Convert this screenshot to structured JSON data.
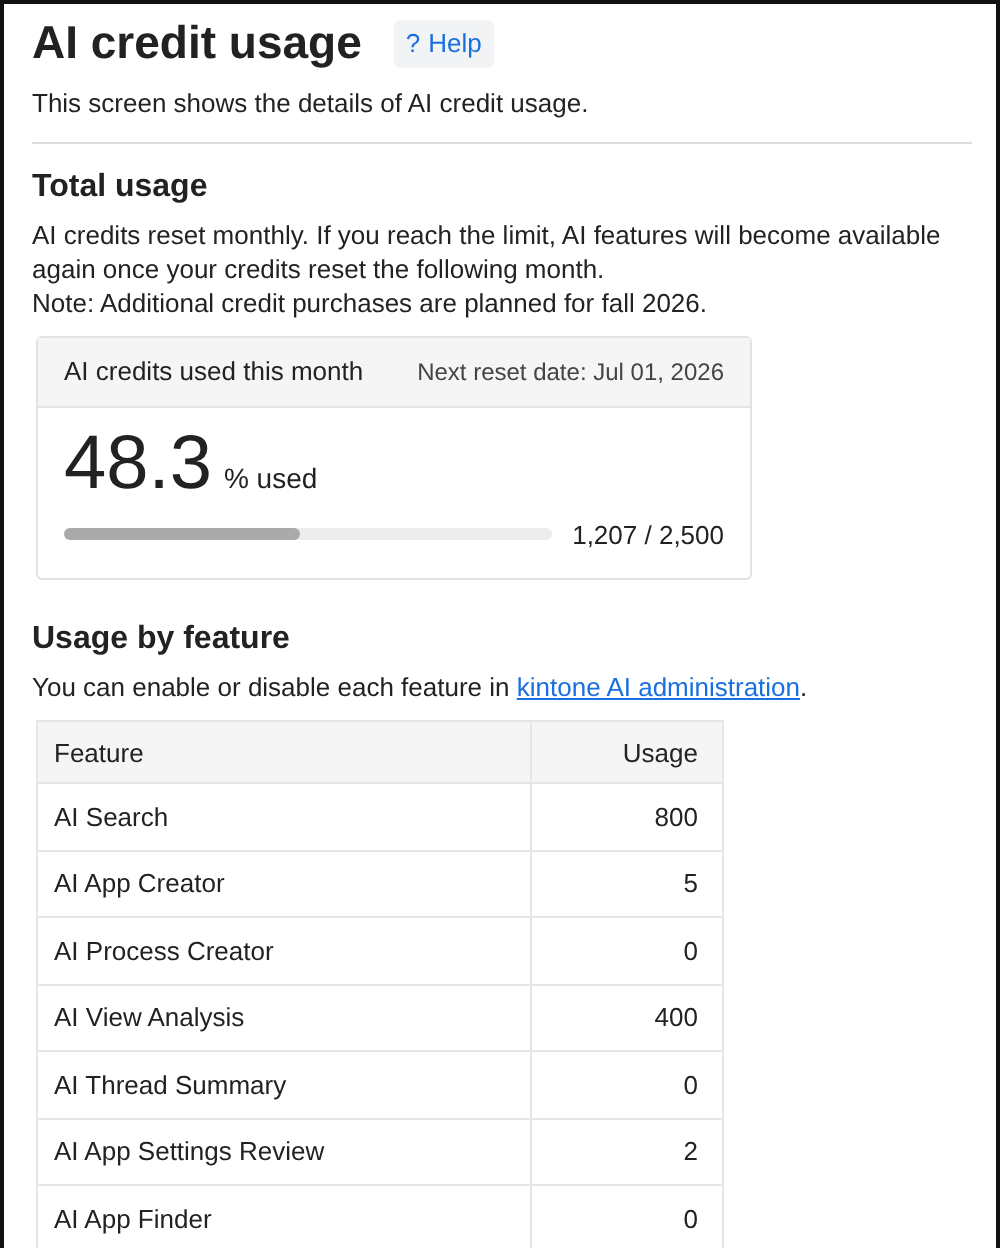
{
  "title": "AI credit usage",
  "help": {
    "icon": "?",
    "label": "Help"
  },
  "description": "This screen shows the details of AI credit usage.",
  "total_usage": {
    "heading": "Total usage",
    "paragraphs": [
      "AI credits reset monthly. If you reach the limit, AI features will become available again once your credits reset the following month.",
      "Note: Additional credit purchases are planned for fall 2026."
    ],
    "card": {
      "title": "AI credits used this month",
      "reset_date": "Next reset date: Jul 01, 2026",
      "percent": "48.3",
      "percent_unit": "% used",
      "level": 0.483,
      "reading": "1,207 / 2,500"
    }
  },
  "usage_by_feature": {
    "heading": "Usage by feature",
    "note_before": "You can enable or disable each feature in ",
    "note_link": "kintone AI administration",
    "note_after": ".",
    "table": {
      "columns": [
        "Feature",
        "Usage"
      ],
      "rows": [
        [
          "AI Search",
          "800"
        ],
        [
          "AI App Creator",
          "5"
        ],
        [
          "AI Process Creator",
          "0"
        ],
        [
          "AI View Analysis",
          "400"
        ],
        [
          "AI Thread Summary",
          "0"
        ],
        [
          "AI App Settings Review",
          "2"
        ],
        [
          "AI App Finder",
          "0"
        ]
      ]
    }
  }
}
